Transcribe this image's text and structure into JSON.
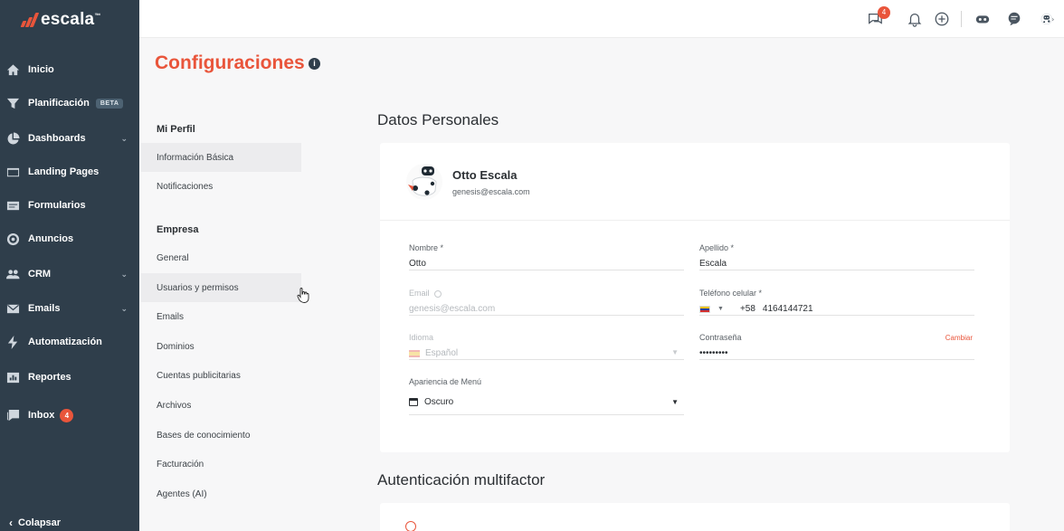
{
  "sidebar": {
    "logo": "escala",
    "logo_tm": "™",
    "items": [
      {
        "label": "Inicio",
        "icon": "home-icon"
      },
      {
        "label": "Planificación",
        "icon": "funnel-icon",
        "tag": "BETA"
      },
      {
        "label": "Dashboards",
        "icon": "pie-chart-icon",
        "chevron": true
      },
      {
        "label": "Landing Pages",
        "icon": "landing-page-icon"
      },
      {
        "label": "Formularios",
        "icon": "form-icon"
      },
      {
        "label": "Anuncios",
        "icon": "target-icon"
      },
      {
        "label": "CRM",
        "icon": "users-icon",
        "chevron": true
      },
      {
        "label": "Emails",
        "icon": "mail-icon",
        "chevron": true
      },
      {
        "label": "Automatización",
        "icon": "bolt-icon"
      },
      {
        "label": "Reportes",
        "icon": "report-icon"
      },
      {
        "label": "Inbox",
        "icon": "inbox-icon",
        "badge": "4"
      }
    ],
    "collapse_label": "Colapsar"
  },
  "topbar": {
    "chat_badge": "4"
  },
  "page": {
    "title": "Configuraciones",
    "info": "i"
  },
  "settings_menu": {
    "group_profile": "Mi Perfil",
    "profile_items": [
      "Información Básica",
      "Notificaciones"
    ],
    "group_company": "Empresa",
    "company_items": [
      "General",
      "Usuarios y permisos",
      "Emails",
      "Dominios",
      "Cuentas publicitarias",
      "Archivos",
      "Bases de conocimiento",
      "Facturación",
      "Agentes (AI)"
    ]
  },
  "personal": {
    "section_title": "Datos Personales",
    "name": "Otto Escala",
    "email": "genesis@escala.com",
    "fields": {
      "nombre_label": "Nombre *",
      "nombre_value": "Otto",
      "apellido_label": "Apellido *",
      "apellido_value": "Escala",
      "email_label": "Email",
      "email_value": "genesis@escala.com",
      "telefono_label": "Teléfono celular *",
      "telefono_code": "+58",
      "telefono_value": "4164144721",
      "idioma_label": "Idioma",
      "idioma_value": "Español",
      "contrasena_label": "Contraseña",
      "contrasena_value": "•••••••••",
      "cambiar_label": "Cambiar",
      "apariencia_label": "Apariencia de Menú",
      "apariencia_value": "Oscuro"
    }
  },
  "mfa": {
    "section_title": "Autenticación multifactor"
  },
  "colors": {
    "accent": "#e9553b",
    "sidebar_bg": "#2f3e4b"
  }
}
